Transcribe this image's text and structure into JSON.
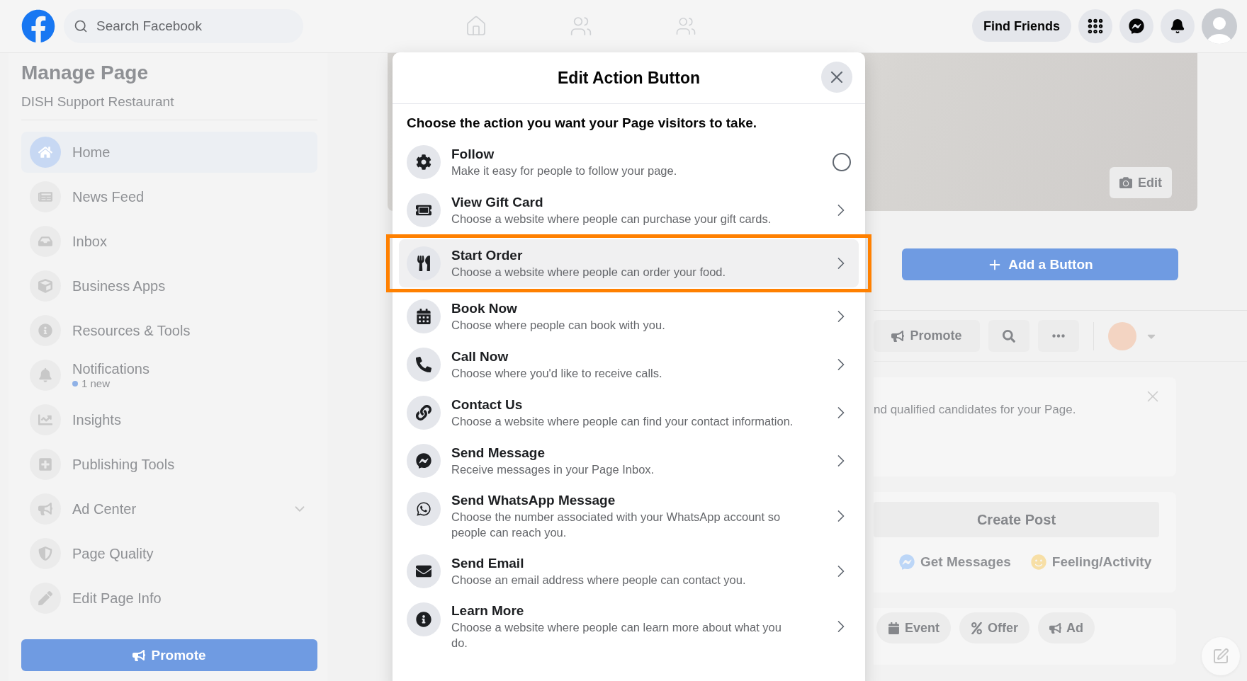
{
  "header": {
    "search": {
      "placeholder": "Search Facebook"
    },
    "find_friends": "Find Friends"
  },
  "sidebar": {
    "title": "Manage Page",
    "subtitle": "DISH Support Restaurant",
    "items": [
      {
        "label": "Home",
        "selected": true
      },
      {
        "label": "News Feed",
        "selected": false
      },
      {
        "label": "Inbox",
        "selected": false
      },
      {
        "label": "Business Apps",
        "selected": false
      },
      {
        "label": "Resources & Tools",
        "selected": false
      },
      {
        "label": "Notifications",
        "selected": false,
        "badge": "1 new"
      },
      {
        "label": "Insights",
        "selected": false
      },
      {
        "label": "Publishing Tools",
        "selected": false
      },
      {
        "label": "Ad Center",
        "selected": false,
        "expanded": false
      },
      {
        "label": "Page Quality",
        "selected": false
      },
      {
        "label": "Edit Page Info",
        "selected": false
      }
    ],
    "promote": "Promote"
  },
  "page": {
    "cover_edit": "Edit",
    "add_button": "Add a Button",
    "promote": "Promote",
    "card_text": "nd qualified candidates for your Page.",
    "create_post": "Create Post",
    "composer_actions": [
      "Get Messages",
      "Feeling/Activity"
    ],
    "post_types": [
      "Event",
      "Offer",
      "Ad"
    ]
  },
  "dialog": {
    "title": "Edit Action Button",
    "prompt": "Choose the action you want your Page visitors to take.",
    "options": [
      {
        "kind": "radio",
        "title": "Follow",
        "description": "Make it easy for people to follow your page.",
        "checked": false,
        "selected": false,
        "highlighted": false
      },
      {
        "kind": "link",
        "title": "View Gift Card",
        "description": "Choose a website where people can purchase your gift cards.",
        "selected": false,
        "highlighted": false
      },
      {
        "kind": "link",
        "title": "Start Order",
        "description": "Choose a website where people can order your food.",
        "selected": true,
        "highlighted": true
      },
      {
        "kind": "link",
        "title": "Book Now",
        "description": "Choose where people can book with you.",
        "selected": false,
        "highlighted": false
      },
      {
        "kind": "link",
        "title": "Call Now",
        "description": "Choose where you'd like to receive calls.",
        "selected": false,
        "highlighted": false
      },
      {
        "kind": "link",
        "title": "Contact Us",
        "description": "Choose a website where people can find your contact information.",
        "selected": false,
        "highlighted": false
      },
      {
        "kind": "link",
        "title": "Send Message",
        "description": "Receive messages in your Page Inbox.",
        "selected": false,
        "highlighted": false
      },
      {
        "kind": "link",
        "title": "Send WhatsApp Message",
        "description": "Choose the number associated with your WhatsApp account so people can reach you.",
        "selected": false,
        "highlighted": false
      },
      {
        "kind": "link",
        "title": "Send Email",
        "description": "Choose an email address where people can contact you.",
        "selected": false,
        "highlighted": false
      },
      {
        "kind": "link",
        "title": "Learn More",
        "description": "Choose a website where people can learn more about what you do.",
        "selected": false,
        "highlighted": false
      }
    ]
  }
}
